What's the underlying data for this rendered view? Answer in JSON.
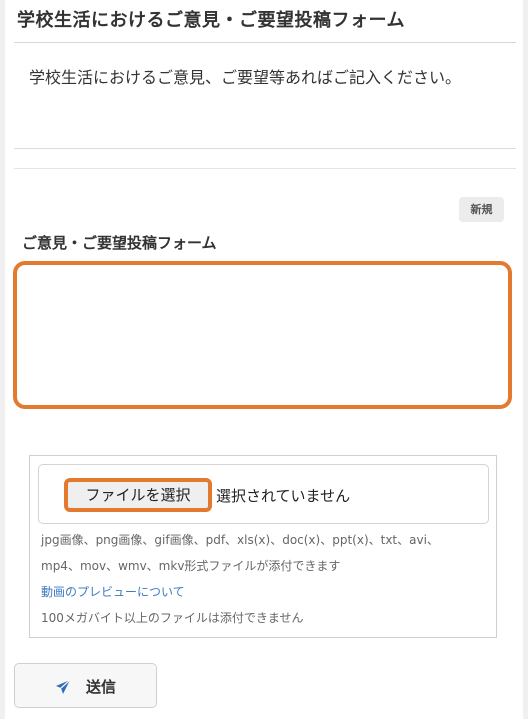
{
  "page": {
    "title": "学校生活におけるご意見・ご要望投稿フォーム",
    "description": "学校生活におけるご意見、ご要望等あればご記入ください。"
  },
  "form": {
    "new_badge": "新規",
    "label": "ご意見・ご要望投稿フォーム",
    "textarea_value": ""
  },
  "attachments": {
    "choose_button": "ファイルを選択",
    "status": "選択されていません",
    "formats_line1": "jpg画像、png画像、gif画像、pdf、xls(x)、doc(x)、ppt(x)、txt、avi、",
    "formats_line2": "mp4、mov、wmv、mkv形式ファイルが添付できます",
    "preview_link": "動画のプレビューについて",
    "size_note": "100メガバイト以上のファイルは添付できません"
  },
  "submit": {
    "label": "送信",
    "icon": "send-icon"
  },
  "colors": {
    "focus_orange": "#e27b2f",
    "link_blue": "#3f7bc2",
    "send_icon": "#2f6db5"
  }
}
